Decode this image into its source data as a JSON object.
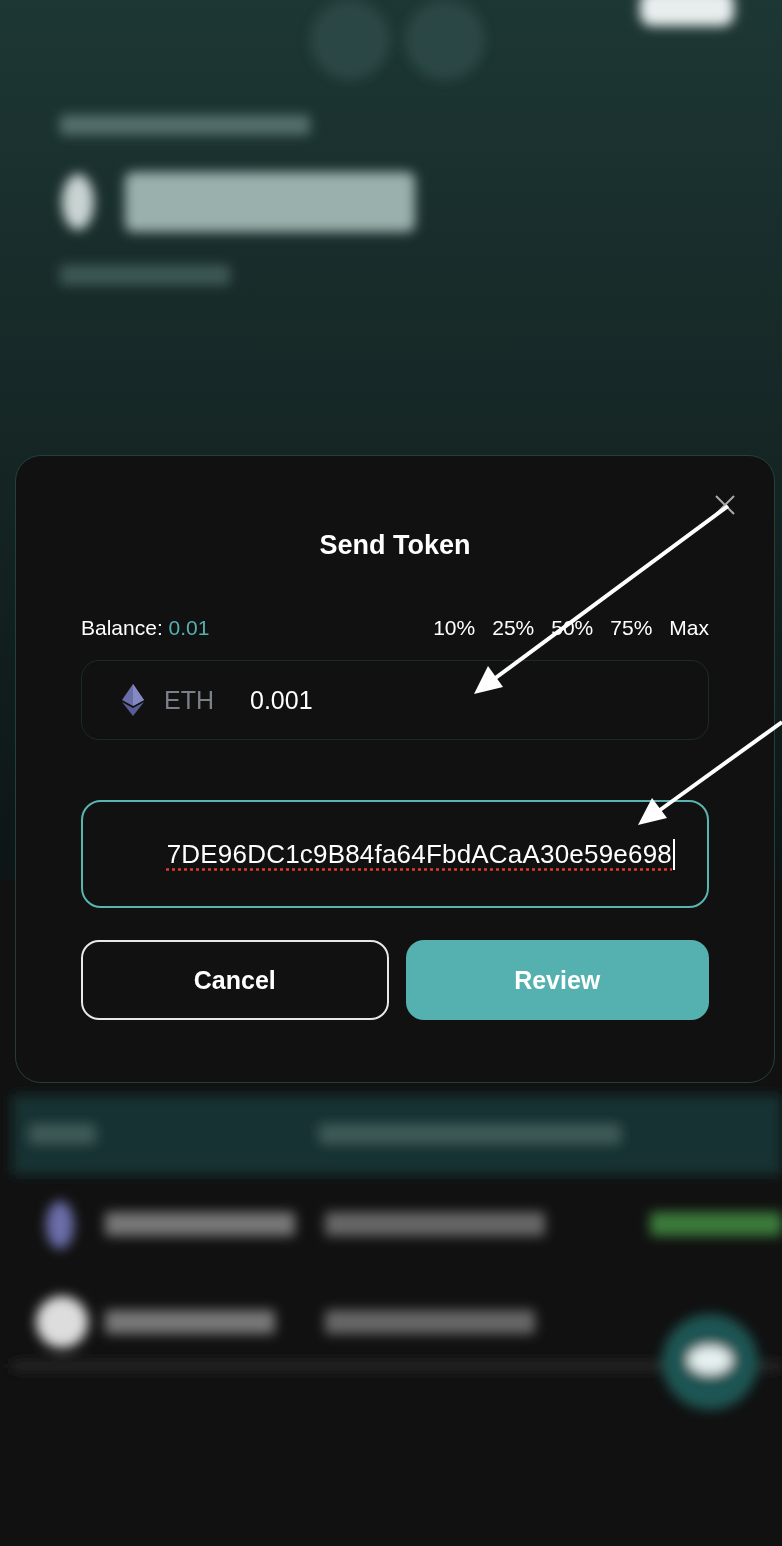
{
  "dialog": {
    "title": "Send Token",
    "balance": {
      "label": "Balance:",
      "value": "0.01"
    },
    "percent_options": [
      "10%",
      "25%",
      "50%",
      "75%",
      "Max"
    ],
    "amount_field": {
      "token": "ETH",
      "value": "0.001"
    },
    "address_field": {
      "value": "7DE96DC1c9B84fa64FbdACaA30e59e698",
      "focused": true
    },
    "buttons": [
      {
        "label": "Cancel",
        "kind": "secondary"
      },
      {
        "label": "Review",
        "kind": "primary"
      }
    ]
  }
}
